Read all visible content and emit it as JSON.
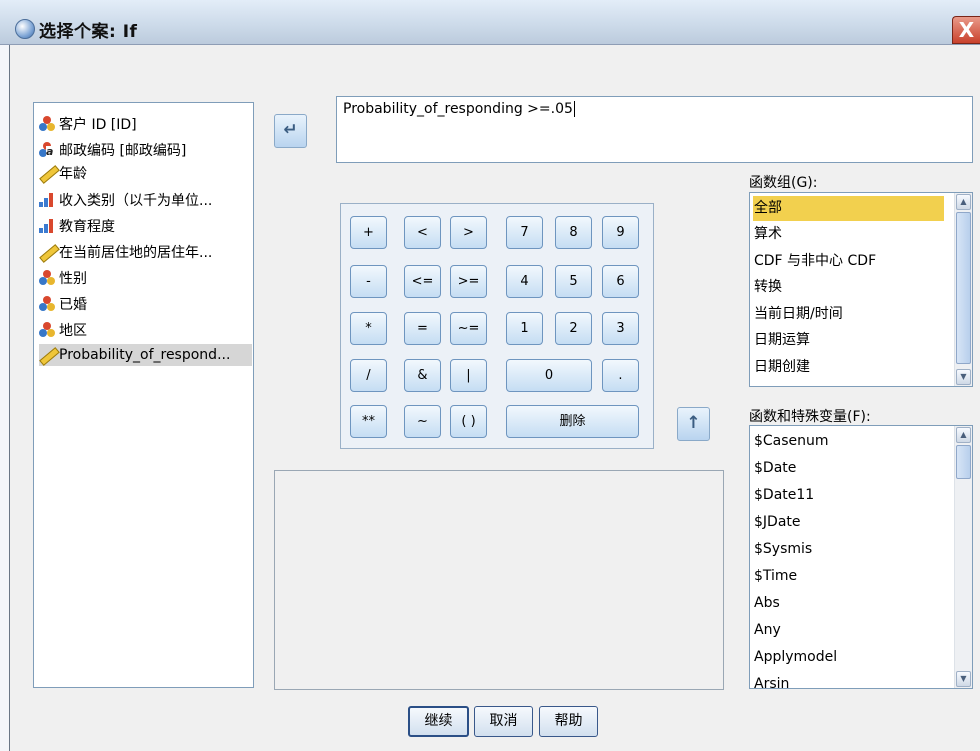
{
  "window": {
    "title": "选择个案: If",
    "close_glyph": "X"
  },
  "variables": [
    {
      "label": "客户 ID [ID]",
      "icon": "nominal-icon"
    },
    {
      "label": "邮政编码 [邮政编码]",
      "icon": "string-nominal-icon"
    },
    {
      "label": "年龄",
      "icon": "scale-icon"
    },
    {
      "label": "收入类别（以千为单位...",
      "icon": "ordinal-icon"
    },
    {
      "label": "教育程度",
      "icon": "ordinal-icon"
    },
    {
      "label": "在当前居住地的居住年...",
      "icon": "scale-icon"
    },
    {
      "label": "性别",
      "icon": "nominal-icon"
    },
    {
      "label": "已婚",
      "icon": "nominal-icon"
    },
    {
      "label": "地区",
      "icon": "nominal-icon"
    },
    {
      "label": "Probability_of_respond...",
      "icon": "scale-icon",
      "selected": true
    }
  ],
  "expression": "Probability_of_responding >=.05",
  "keypad": {
    "plus": "+",
    "lt": "<",
    "gt": ">",
    "seven": "7",
    "eight": "8",
    "nine": "9",
    "minus": "-",
    "le": "<=",
    "ge": ">=",
    "four": "4",
    "five": "5",
    "six": "6",
    "times": "*",
    "eq": "=",
    "ne": "~=",
    "one": "1",
    "two": "2",
    "three": "3",
    "div": "/",
    "and": "&",
    "or": "|",
    "zero": "0",
    "dot": ".",
    "pow": "**",
    "not": "~",
    "paren": "( )",
    "delete": "删除"
  },
  "function_group": {
    "label": "函数组(G):",
    "items": [
      "全部",
      "算术",
      "CDF 与非中心 CDF",
      "转换",
      "当前日期/时间",
      "日期运算",
      "日期创建"
    ],
    "selected_index": 0
  },
  "functions": {
    "label": "函数和特殊变量(F):",
    "items": [
      "$Casenum",
      "$Date",
      "$Date11",
      "$JDate",
      "$Sysmis",
      "$Time",
      "Abs",
      "Any",
      "Applymodel",
      "Arsin"
    ]
  },
  "buttons": {
    "continue": "继续",
    "cancel": "取消",
    "help": "帮助"
  }
}
